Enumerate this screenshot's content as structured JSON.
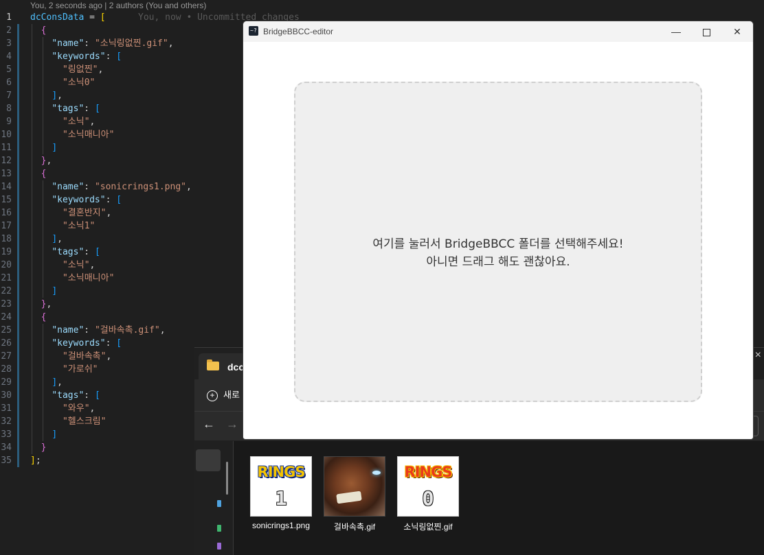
{
  "editor": {
    "blame_header": "You, 2 seconds ago | 2 authors (You and others)",
    "ghost_text": "You, now • Uncommitted changes",
    "active_line": 1,
    "line_numbers": [
      "1",
      "2",
      "3",
      "4",
      "5",
      "6",
      "7",
      "8",
      "9",
      "10",
      "11",
      "12",
      "13",
      "14",
      "15",
      "16",
      "17",
      "18",
      "19",
      "20",
      "21",
      "22",
      "23",
      "24",
      "25",
      "26",
      "27",
      "28",
      "29",
      "30",
      "31",
      "32",
      "33",
      "34",
      "35"
    ],
    "lines": [
      [
        {
          "t": "dcConsData",
          "c": "id"
        },
        {
          "t": " = ",
          "c": "p"
        },
        {
          "t": "[",
          "c": "b1"
        }
      ],
      [
        {
          "t": "  ",
          "c": "p"
        },
        {
          "t": "{",
          "c": "b2"
        }
      ],
      [
        {
          "t": "    ",
          "c": "p"
        },
        {
          "t": "\"name\"",
          "c": "k"
        },
        {
          "t": ": ",
          "c": "p"
        },
        {
          "t": "\"소닉링없찐.gif\"",
          "c": "s"
        },
        {
          "t": ",",
          "c": "p"
        }
      ],
      [
        {
          "t": "    ",
          "c": "p"
        },
        {
          "t": "\"keywords\"",
          "c": "k"
        },
        {
          "t": ": ",
          "c": "p"
        },
        {
          "t": "[",
          "c": "b3"
        }
      ],
      [
        {
          "t": "      ",
          "c": "p"
        },
        {
          "t": "\"링없찐\"",
          "c": "s"
        },
        {
          "t": ",",
          "c": "p"
        }
      ],
      [
        {
          "t": "      ",
          "c": "p"
        },
        {
          "t": "\"소닉0\"",
          "c": "s"
        }
      ],
      [
        {
          "t": "    ",
          "c": "p"
        },
        {
          "t": "]",
          "c": "b3"
        },
        {
          "t": ",",
          "c": "p"
        }
      ],
      [
        {
          "t": "    ",
          "c": "p"
        },
        {
          "t": "\"tags\"",
          "c": "k"
        },
        {
          "t": ": ",
          "c": "p"
        },
        {
          "t": "[",
          "c": "b3"
        }
      ],
      [
        {
          "t": "      ",
          "c": "p"
        },
        {
          "t": "\"소닉\"",
          "c": "s"
        },
        {
          "t": ",",
          "c": "p"
        }
      ],
      [
        {
          "t": "      ",
          "c": "p"
        },
        {
          "t": "\"소닉매니아\"",
          "c": "s"
        }
      ],
      [
        {
          "t": "    ",
          "c": "p"
        },
        {
          "t": "]",
          "c": "b3"
        }
      ],
      [
        {
          "t": "  ",
          "c": "p"
        },
        {
          "t": "}",
          "c": "b2"
        },
        {
          "t": ",",
          "c": "p"
        }
      ],
      [
        {
          "t": "  ",
          "c": "p"
        },
        {
          "t": "{",
          "c": "b2"
        }
      ],
      [
        {
          "t": "    ",
          "c": "p"
        },
        {
          "t": "\"name\"",
          "c": "k"
        },
        {
          "t": ": ",
          "c": "p"
        },
        {
          "t": "\"sonicrings1.png\"",
          "c": "s"
        },
        {
          "t": ",",
          "c": "p"
        }
      ],
      [
        {
          "t": "    ",
          "c": "p"
        },
        {
          "t": "\"keywords\"",
          "c": "k"
        },
        {
          "t": ": ",
          "c": "p"
        },
        {
          "t": "[",
          "c": "b3"
        }
      ],
      [
        {
          "t": "      ",
          "c": "p"
        },
        {
          "t": "\"결혼반지\"",
          "c": "s"
        },
        {
          "t": ",",
          "c": "p"
        }
      ],
      [
        {
          "t": "      ",
          "c": "p"
        },
        {
          "t": "\"소닉1\"",
          "c": "s"
        }
      ],
      [
        {
          "t": "    ",
          "c": "p"
        },
        {
          "t": "]",
          "c": "b3"
        },
        {
          "t": ",",
          "c": "p"
        }
      ],
      [
        {
          "t": "    ",
          "c": "p"
        },
        {
          "t": "\"tags\"",
          "c": "k"
        },
        {
          "t": ": ",
          "c": "p"
        },
        {
          "t": "[",
          "c": "b3"
        }
      ],
      [
        {
          "t": "      ",
          "c": "p"
        },
        {
          "t": "\"소닉\"",
          "c": "s"
        },
        {
          "t": ",",
          "c": "p"
        }
      ],
      [
        {
          "t": "      ",
          "c": "p"
        },
        {
          "t": "\"소닉매니아\"",
          "c": "s"
        }
      ],
      [
        {
          "t": "    ",
          "c": "p"
        },
        {
          "t": "]",
          "c": "b3"
        }
      ],
      [
        {
          "t": "  ",
          "c": "p"
        },
        {
          "t": "}",
          "c": "b2"
        },
        {
          "t": ",",
          "c": "p"
        }
      ],
      [
        {
          "t": "  ",
          "c": "p"
        },
        {
          "t": "{",
          "c": "b2"
        }
      ],
      [
        {
          "t": "    ",
          "c": "p"
        },
        {
          "t": "\"name\"",
          "c": "k"
        },
        {
          "t": ": ",
          "c": "p"
        },
        {
          "t": "\"걸바속촉.gif\"",
          "c": "s"
        },
        {
          "t": ",",
          "c": "p"
        }
      ],
      [
        {
          "t": "    ",
          "c": "p"
        },
        {
          "t": "\"keywords\"",
          "c": "k"
        },
        {
          "t": ": ",
          "c": "p"
        },
        {
          "t": "[",
          "c": "b3"
        }
      ],
      [
        {
          "t": "      ",
          "c": "p"
        },
        {
          "t": "\"걸바속촉\"",
          "c": "s"
        },
        {
          "t": ",",
          "c": "p"
        }
      ],
      [
        {
          "t": "      ",
          "c": "p"
        },
        {
          "t": "\"가로쉬\"",
          "c": "s"
        }
      ],
      [
        {
          "t": "    ",
          "c": "p"
        },
        {
          "t": "]",
          "c": "b3"
        },
        {
          "t": ",",
          "c": "p"
        }
      ],
      [
        {
          "t": "    ",
          "c": "p"
        },
        {
          "t": "\"tags\"",
          "c": "k"
        },
        {
          "t": ": ",
          "c": "p"
        },
        {
          "t": "[",
          "c": "b3"
        }
      ],
      [
        {
          "t": "      ",
          "c": "p"
        },
        {
          "t": "\"와우\"",
          "c": "s"
        },
        {
          "t": ",",
          "c": "p"
        }
      ],
      [
        {
          "t": "      ",
          "c": "p"
        },
        {
          "t": "\"헬스크림\"",
          "c": "s"
        }
      ],
      [
        {
          "t": "    ",
          "c": "p"
        },
        {
          "t": "]",
          "c": "b3"
        }
      ],
      [
        {
          "t": "  ",
          "c": "p"
        },
        {
          "t": "}",
          "c": "b2"
        }
      ],
      [
        {
          "t": "]",
          "c": "b1"
        },
        {
          "t": ";",
          "c": "p"
        }
      ]
    ]
  },
  "explorer": {
    "tab_title": "dcco",
    "new_button_label": "새로",
    "back_icon": "←",
    "forward_icon": "→",
    "close_icon": "×",
    "files": [
      {
        "name": "sonicrings1.png",
        "thumb": "rings-blue",
        "thumb_title": "RINGS",
        "thumb_number": "1"
      },
      {
        "name": "걸바속촉.gif",
        "thumb": "orc-portrait"
      },
      {
        "name": "소닉링없찐.gif",
        "thumb": "rings-red",
        "thumb_title": "RINGS",
        "thumb_number": "0"
      }
    ]
  },
  "app": {
    "title": "BridgeBBCC-editor",
    "icon_glyph": "~?",
    "min_icon": "—",
    "close_icon": "✕",
    "drop_text_line1": "여기를 눌러서 BridgeBBCC 폴더를 선택해주세요!",
    "drop_text_line2": "아니면 드래그 해도 괜찮아요."
  },
  "colors": {
    "editor_bg": "#1f1f1f",
    "key": "#9cdcfe",
    "string": "#ce9178",
    "bracket_1": "#ffd700",
    "bracket_2": "#da70d6",
    "bracket_3": "#179fff",
    "drop_zone_bg": "#efefef"
  }
}
